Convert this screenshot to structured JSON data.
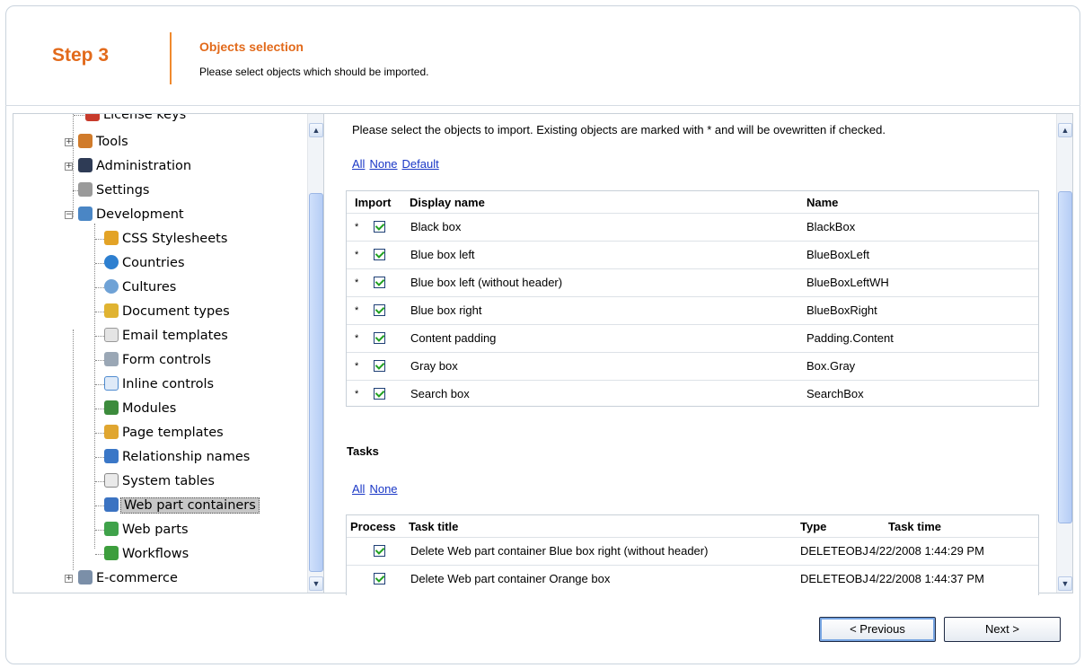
{
  "header": {
    "step": "Step 3",
    "title": "Objects selection",
    "description": "Please select objects which should be imported."
  },
  "tree": {
    "items": [
      {
        "label": "License keys",
        "icon": "license-keys-icon",
        "color": "#c73a2b"
      },
      {
        "label": "Tools",
        "icon": "tools-icon",
        "color": "#d07b2b"
      },
      {
        "label": "Administration",
        "icon": "administration-icon",
        "color": "#2e3b55"
      },
      {
        "label": "Settings",
        "icon": "wrench-icon",
        "color": "#8a8a8a"
      },
      {
        "label": "Development",
        "icon": "development-icon",
        "color": "#4a86c5"
      },
      {
        "label": "CSS Stylesheets",
        "icon": "brush-icon",
        "color": "#e3a326"
      },
      {
        "label": "Countries",
        "icon": "globe-icon",
        "color": "#2d7fd0"
      },
      {
        "label": "Cultures",
        "icon": "culture-globe-icon",
        "color": "#6fa2d6"
      },
      {
        "label": "Document types",
        "icon": "document-types-icon",
        "color": "#e0b331"
      },
      {
        "label": "Email templates",
        "icon": "envelope-icon",
        "color": "#d5d5d5"
      },
      {
        "label": "Form controls",
        "icon": "form-pen-icon",
        "color": "#9aa7b5"
      },
      {
        "label": "Inline controls",
        "icon": "inline-controls-icon",
        "color": "#4f8bd0"
      },
      {
        "label": "Modules",
        "icon": "modules-icon",
        "color": "#3c8b3c"
      },
      {
        "label": "Page templates",
        "icon": "page-templates-icon",
        "color": "#e0a630"
      },
      {
        "label": "Relationship names",
        "icon": "relationship-icon",
        "color": "#3a77c7"
      },
      {
        "label": "System tables",
        "icon": "table-icon",
        "color": "#b9b9b9"
      },
      {
        "label": "Web part containers",
        "icon": "web-part-container-icon",
        "color": "#3b73c2"
      },
      {
        "label": "Web parts",
        "icon": "web-parts-icon",
        "color": "#3fa24a"
      },
      {
        "label": "Workflows",
        "icon": "checkmark-icon",
        "color": "#3d9e3d"
      },
      {
        "label": "E-commerce",
        "icon": "cart-icon",
        "color": "#7b8fa8"
      }
    ]
  },
  "objects": {
    "intro": "Please select the objects to import. Existing objects are marked with * and will be ovewritten if checked.",
    "links": {
      "all": "All",
      "none": "None",
      "default": "Default"
    },
    "columns": {
      "import": "Import",
      "display_name": "Display name",
      "name": "Name"
    },
    "rows": [
      {
        "mark": "*",
        "display_name": "Black box",
        "name": "BlackBox"
      },
      {
        "mark": "*",
        "display_name": "Blue box left",
        "name": "BlueBoxLeft"
      },
      {
        "mark": "*",
        "display_name": "Blue box left (without header)",
        "name": "BlueBoxLeftWH"
      },
      {
        "mark": "*",
        "display_name": "Blue box right",
        "name": "BlueBoxRight"
      },
      {
        "mark": "*",
        "display_name": "Content padding",
        "name": "Padding.Content"
      },
      {
        "mark": "*",
        "display_name": "Gray box",
        "name": "Box.Gray"
      },
      {
        "mark": "*",
        "display_name": "Search box",
        "name": "SearchBox"
      }
    ]
  },
  "tasks": {
    "title": "Tasks",
    "links": {
      "all": "All",
      "none": "None"
    },
    "columns": {
      "process": "Process",
      "task_title": "Task title",
      "type": "Type",
      "task_time": "Task time"
    },
    "rows": [
      {
        "task_title": "Delete Web part container Blue box right (without header)",
        "type": "DELETEOBJ",
        "task_time": "4/22/2008 1:44:29 PM"
      },
      {
        "task_title": "Delete Web part container Orange box",
        "type": "DELETEOBJ",
        "task_time": "4/22/2008 1:44:37 PM"
      }
    ]
  },
  "buttons": {
    "previous": "< Previous",
    "next": "Next >"
  },
  "colors": {
    "accent": "#e26a1b",
    "link": "#1a37c6",
    "check": "#21a121"
  }
}
